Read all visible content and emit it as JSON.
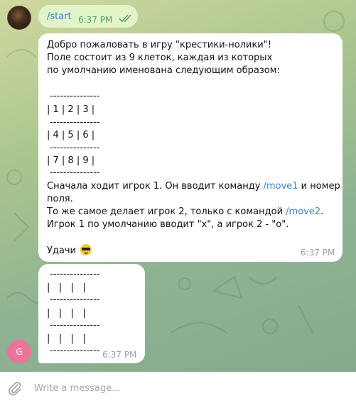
{
  "outgoing": {
    "text": "/start",
    "time": "6:37 PM",
    "read_status": "double-check-icon"
  },
  "welcome_message": {
    "lines": [
      "Добро пожаловать в игру \"крестики-нолики\"!",
      "Поле состоит из 9 клеток, каждая из которых",
      "по умолчанию именована следующим образом:",
      " ---------------",
      "| 1 | 2 | 3 |",
      " ---------------",
      "| 4 | 5 | 6 |",
      " ---------------",
      "| 7 | 8 | 9 |",
      " ---------------"
    ],
    "instr1_before": "Сначала ходит игрок 1. Он вводит команду ",
    "instr1_link": "/move1",
    "instr1_after": " и номер",
    "instr1_cont": "поля.",
    "instr2_before": "То же самое делает игрок 2, только с командой ",
    "instr2_link": "/move2",
    "instr2_after": ".",
    "instr3": "Игрок 1 по умолчанию вводит \"x\", а игрок 2 - \"o\".",
    "farewell": "Удачи",
    "emoji": "smiling-face-with-sunglasses-emoji",
    "time": "6:37 PM"
  },
  "board_message": {
    "lines": [
      " ---------------",
      "|   |   |   |",
      " ---------------",
      "|   |   |   |",
      " ---------------",
      "|   |   |   |",
      " ---------------"
    ],
    "time": "6:37 PM"
  },
  "bot_avatar_letter": "G",
  "composer": {
    "placeholder": "Write a message...",
    "attach_icon": "paperclip-icon"
  },
  "colors": {
    "link": "#3a83c8",
    "outgoing_bubble": "#e1f5c9",
    "bot_avatar": "#e8769b"
  }
}
